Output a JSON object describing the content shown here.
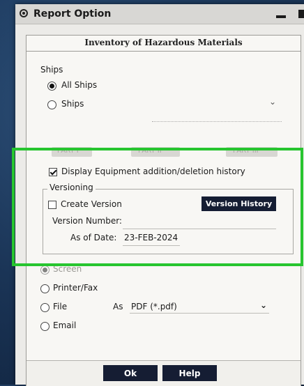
{
  "window": {
    "title": "Report Option"
  },
  "header": {
    "title": "Inventory of Hazardous Materials"
  },
  "ships": {
    "label": "Ships",
    "options": [
      {
        "label": "All Ships",
        "selected": true
      },
      {
        "label": "Ships",
        "selected": false
      }
    ],
    "dropdown_icon": "chevron-down-icon"
  },
  "parts": {
    "part1": "PART I",
    "part2": "PART II",
    "part3": "PART III"
  },
  "display_history": {
    "label": "Display Equipment addition/deletion history",
    "checked": true
  },
  "versioning": {
    "legend": "Versioning",
    "create_version": {
      "label": "Create Version",
      "checked": false
    },
    "version_history_button": "Version History",
    "version_number_label": "Version Number:",
    "version_number_value": "",
    "as_of_date_label": "As of Date:",
    "as_of_date_value": "23-FEB-2024"
  },
  "output": {
    "options": [
      {
        "label": "Screen",
        "selected": true
      },
      {
        "label": "Printer/Fax",
        "selected": false
      },
      {
        "label": "File",
        "selected": false
      },
      {
        "label": "Email",
        "selected": false
      }
    ],
    "as_label": "As",
    "format_value": "PDF (*.pdf)"
  },
  "buttons": {
    "ok": "Ok",
    "help": "Help"
  },
  "colors": {
    "highlight": "#27c52f",
    "button_bg": "#151d33",
    "panel_bg": "#f8f7f4"
  }
}
